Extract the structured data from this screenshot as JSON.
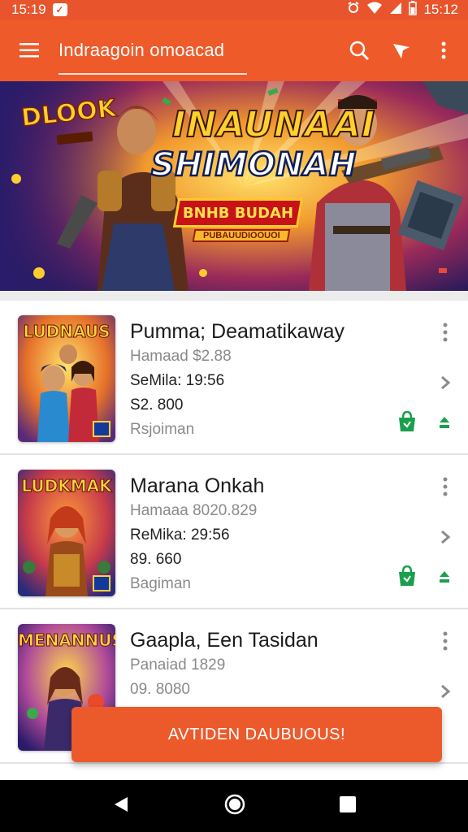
{
  "status_bar": {
    "time_left": "15:19",
    "time_right": "15:12"
  },
  "app_bar": {
    "title": "Indraagoin omoacad"
  },
  "banner": {
    "logo_text": "DLOOK",
    "title_line1": "INAUNAAI",
    "title_line2": "SHIMONAH",
    "ribbon_text": "BNHB BUDAH",
    "ribbon_sub": "PUBAUUDIOOUOI"
  },
  "items": [
    {
      "thumb_logo": "LUDNAUS",
      "title": "Pumma; Deamatikaway",
      "line1": "Hamaad $2.88",
      "line2": "SeMila: 19:56",
      "line3": "S2. 800",
      "line4": "Rsjoiman"
    },
    {
      "thumb_logo": "LUDKMAK",
      "title": "Marana Onkah",
      "line1": "Hamaaa 8020.829",
      "line2": "ReMika: 29:56",
      "line3": "89. 660",
      "line4": "Bagiman"
    },
    {
      "thumb_logo": "MENANNUS",
      "title": "Gaapla, Een Tasidan",
      "line1": "Panaiad 1829",
      "line3": "09. 8080"
    }
  ],
  "cta_label": "AVTIDEN DAUBUOUS!",
  "colors": {
    "accent": "#ee5a2a",
    "green": "#1aa04d"
  }
}
